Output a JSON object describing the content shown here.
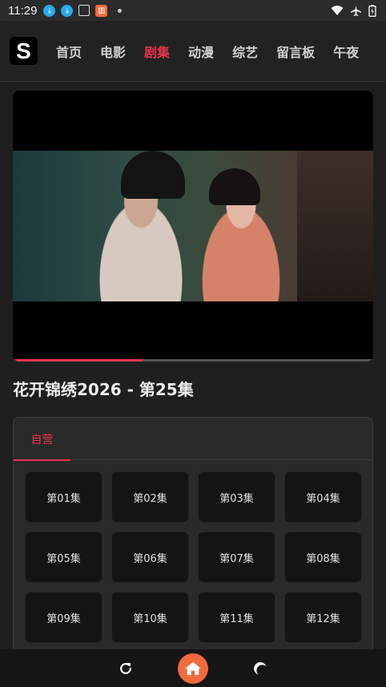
{
  "status_bar": {
    "time": "11:29",
    "icons": [
      "download-icon",
      "download-icon",
      "box-icon",
      "book-app-icon",
      "dot-icon"
    ],
    "right_icons": [
      "wifi-icon",
      "airplane-icon",
      "battery-icon"
    ]
  },
  "header": {
    "logo_letter": "S",
    "nav": [
      {
        "label": "首页",
        "active": false
      },
      {
        "label": "电影",
        "active": false
      },
      {
        "label": "剧集",
        "active": true
      },
      {
        "label": "动漫",
        "active": false
      },
      {
        "label": "综艺",
        "active": false
      },
      {
        "label": "留言板",
        "active": false
      },
      {
        "label": "午夜",
        "active": false
      }
    ]
  },
  "player": {
    "progress": 0.36
  },
  "episode_title": "花开锦绣2026 - 第25集",
  "panel": {
    "source_tab": "自营",
    "episodes": [
      "第01集",
      "第02集",
      "第03集",
      "第04集",
      "第05集",
      "第06集",
      "第07集",
      "第08集",
      "第09集",
      "第10集",
      "第11集",
      "第12集"
    ]
  },
  "bottom_bar": {
    "icons": [
      "refresh-icon",
      "home-icon",
      "night-mode-icon"
    ]
  },
  "colors": {
    "accent": "#e8334e",
    "home_button": "#f26a3d",
    "background": "#1f1f1f"
  }
}
